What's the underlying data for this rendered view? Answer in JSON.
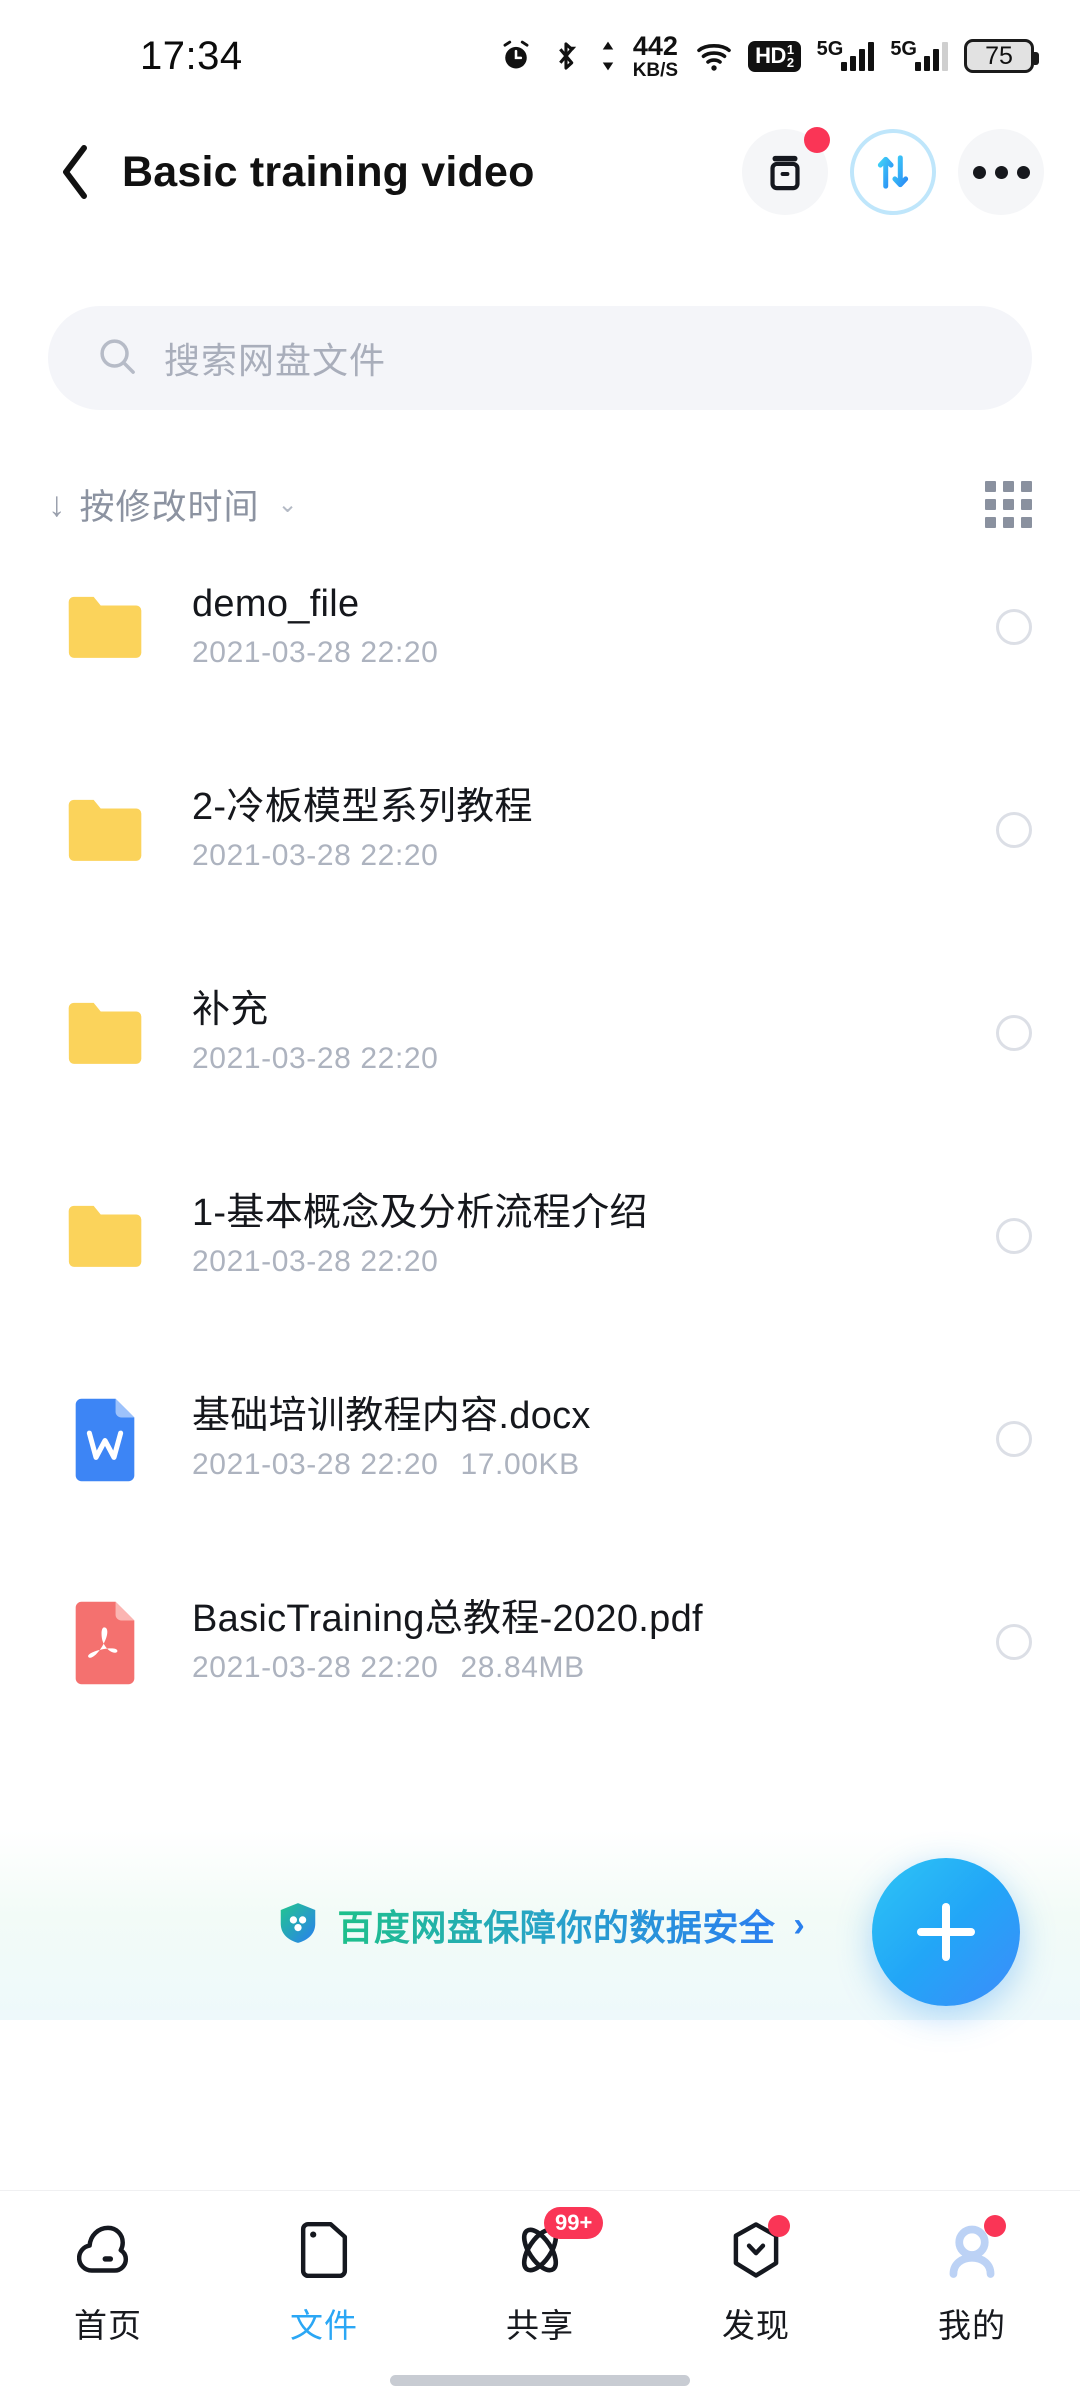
{
  "status_bar": {
    "time": "17:34",
    "net_speed_value": "442",
    "net_speed_unit": "KB/S",
    "hd_label": "HD",
    "hd_sup": "1",
    "hd_sub": "2",
    "sim1_gen": "5G",
    "sim2_gen": "5G",
    "battery_percent": "75",
    "icons": [
      "alarm-icon",
      "bluetooth-icon",
      "wifi-icon",
      "hd-voice-icon",
      "signal-icon",
      "battery-icon"
    ]
  },
  "header": {
    "title": "Basic training video",
    "back_label": "‹",
    "archive_button_name": "archive",
    "transfer_button_name": "transfer",
    "more_button_name": "more"
  },
  "search": {
    "placeholder": "搜索网盘文件"
  },
  "sort": {
    "direction_arrow": "↓",
    "label": "按修改时间",
    "caret": "⌄",
    "view_toggle_name": "grid-view"
  },
  "files": [
    {
      "name": "demo_file",
      "date": "2021-03-28  22:20",
      "size": "",
      "type": "folder"
    },
    {
      "name": "2-冷板模型系列教程",
      "date": "2021-03-28  22:20",
      "size": "",
      "type": "folder"
    },
    {
      "name": "补充",
      "date": "2021-03-28  22:20",
      "size": "",
      "type": "folder"
    },
    {
      "name": "1-基本概念及分析流程介绍",
      "date": "2021-03-28  22:20",
      "size": "",
      "type": "folder"
    },
    {
      "name": "基础培训教程内容.docx",
      "date": "2021-03-28  22:20",
      "size": "17.00KB",
      "type": "word"
    },
    {
      "name": "BasicTraining总教程-2020.pdf",
      "date": "2021-03-28  22:20",
      "size": "28.84MB",
      "type": "pdf"
    }
  ],
  "safety_banner": {
    "text": "百度网盘保障你的数据安全",
    "chevron": "›"
  },
  "fab": {
    "label": "+"
  },
  "bottom_nav": {
    "items": [
      {
        "label": "首页",
        "icon": "cloud-icon",
        "active": false,
        "badge": ""
      },
      {
        "label": "文件",
        "icon": "folder-icon",
        "active": true,
        "badge": ""
      },
      {
        "label": "共享",
        "icon": "share-icon",
        "active": false,
        "badge": "99+"
      },
      {
        "label": "发现",
        "icon": "discover-icon",
        "active": false,
        "badge": "dot"
      },
      {
        "label": "我的",
        "icon": "profile-icon",
        "active": false,
        "badge": "dot"
      }
    ]
  },
  "colors": {
    "accent": "#2ba7f5",
    "folder": "#fbd35b",
    "word": "#3d85f5",
    "pdf": "#f4716f",
    "badge_red": "#fa3556"
  }
}
